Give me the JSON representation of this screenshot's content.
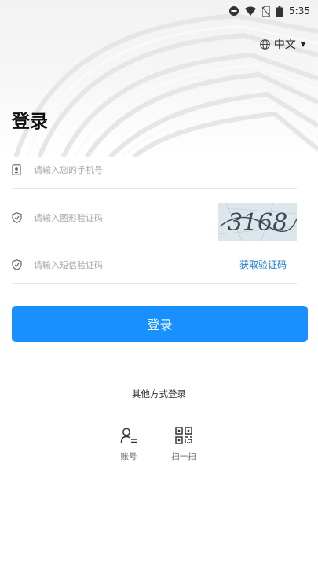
{
  "status_bar": {
    "time": "5:35",
    "icons": [
      "do-not-disturb-icon",
      "wifi-icon",
      "no-sim-icon",
      "battery-icon"
    ]
  },
  "language": {
    "label": "中文",
    "icon": "globe-icon"
  },
  "title": "登录",
  "form": {
    "phone": {
      "placeholder": "请输入您的手机号",
      "icon": "phone-icon"
    },
    "captcha": {
      "placeholder": "请输入图形验证码",
      "icon": "shield-icon",
      "image_text": "3168"
    },
    "sms": {
      "placeholder": "请输入短信验证码",
      "icon": "shield-icon",
      "get_code_label": "获取验证码"
    }
  },
  "login_button": "登录",
  "other_methods": {
    "title": "其他方式登录",
    "items": [
      {
        "label": "账号",
        "icon": "user-account-icon"
      },
      {
        "label": "扫一扫",
        "icon": "qr-code-icon"
      }
    ]
  },
  "colors": {
    "primary": "#1890ff",
    "link": "#1a7bd6",
    "placeholder": "#a9a9a9"
  }
}
